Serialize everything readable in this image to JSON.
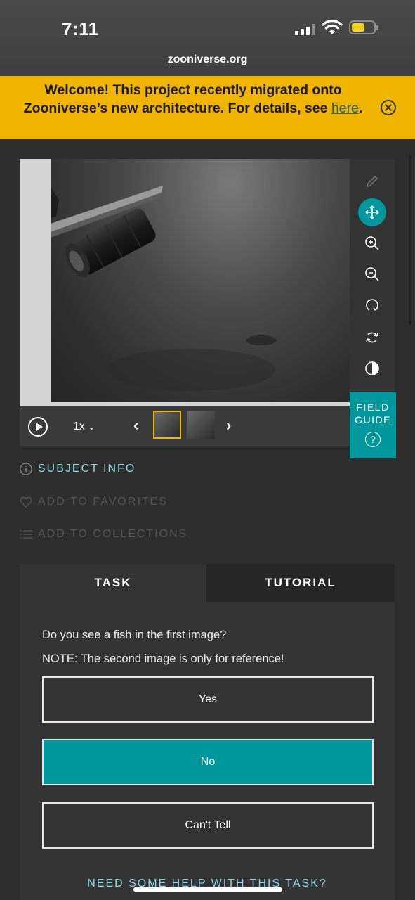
{
  "status_bar": {
    "time": "7:11",
    "url": "zooniverse.org"
  },
  "banner": {
    "text_before": "Welcome! This project recently migrated onto Zooniverse’s new architecture. For details, see ",
    "link": "here",
    "text_after": "."
  },
  "viewer": {
    "speed": "1x",
    "field_guide_line1": "FIELD",
    "field_guide_line2": "GUIDE",
    "field_guide_icon": "?",
    "tools": [
      "pencil-icon",
      "move-icon",
      "zoom-in-icon",
      "zoom-out-icon",
      "rotate-icon",
      "reset-icon",
      "contrast-icon"
    ]
  },
  "meta": {
    "subject_info": "SUBJECT INFO",
    "add_favorites": "ADD TO FAVORITES",
    "add_collections": "ADD TO COLLECTIONS"
  },
  "tabs": {
    "task": "TASK",
    "tutorial": "TUTORIAL"
  },
  "task": {
    "question": "Do you see a fish in the first image?",
    "note": "NOTE: The second image is only for reference!",
    "answers": [
      "Yes",
      "No",
      "Can't Tell"
    ],
    "selected": "No",
    "help": "NEED SOME HELP WITH THIS TASK?"
  },
  "colors": {
    "accent": "#00979d",
    "banner": "#f0b500",
    "background": "#2d2d2d"
  }
}
